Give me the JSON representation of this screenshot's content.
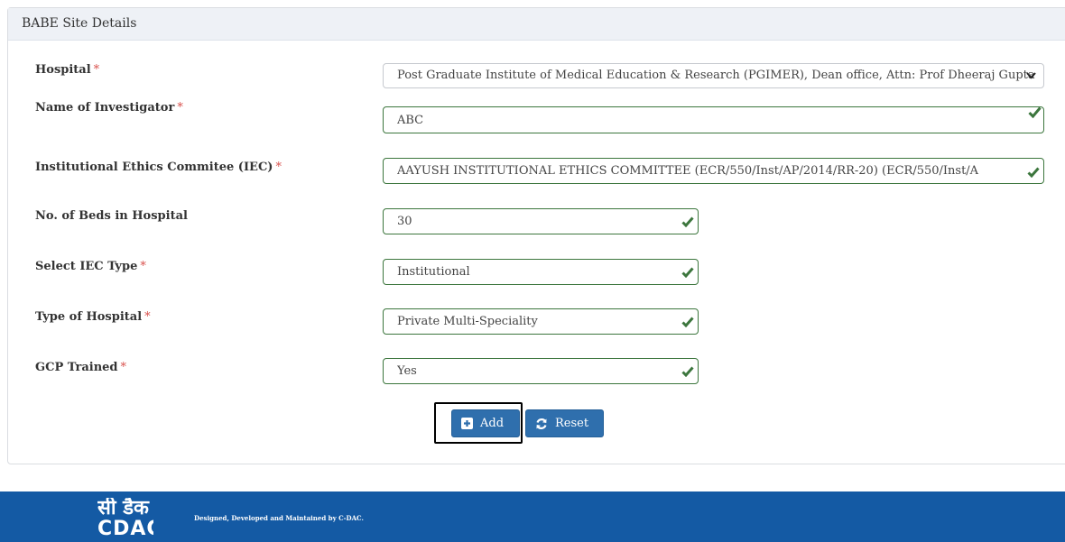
{
  "panel": {
    "title": "BABE Site Details"
  },
  "required_mark": "*",
  "form": {
    "hospital": {
      "label": "Hospital",
      "value": "Post Graduate Institute of Medical Education & Research (PGIMER), Dean office, Attn: Prof Dheeraj Gupta"
    },
    "investigator": {
      "label": "Name of Investigator",
      "value": "ABC"
    },
    "iec": {
      "label": "Institutional Ethics Commitee (IEC)",
      "value": "AAYUSH INSTITUTIONAL ETHICS COMMITTEE (ECR/550/Inst/AP/2014/RR-20) (ECR/550/Inst/A"
    },
    "beds": {
      "label": "No. of Beds in Hospital",
      "value": "30"
    },
    "iec_type": {
      "label": "Select IEC Type",
      "value": "Institutional"
    },
    "hospital_type": {
      "label": "Type of Hospital",
      "value": "Private Multi-Speciality"
    },
    "gcp": {
      "label": "GCP Trained",
      "value": "Yes"
    }
  },
  "buttons": {
    "add": "Add",
    "reset": "Reset"
  },
  "footer": {
    "logo_hindi": "सी डैक",
    "logo_english": "CDAC",
    "text": "Designed, Developed and Maintained by C-DAC."
  },
  "colors": {
    "primary": "#2f6fad",
    "footer": "#145aa4",
    "valid": "#3c763d",
    "required": "#d9534f"
  },
  "icons": {
    "valid": "check-icon",
    "dropdown": "chevron-down-icon",
    "add": "plus-square-icon",
    "reset": "refresh-icon"
  }
}
